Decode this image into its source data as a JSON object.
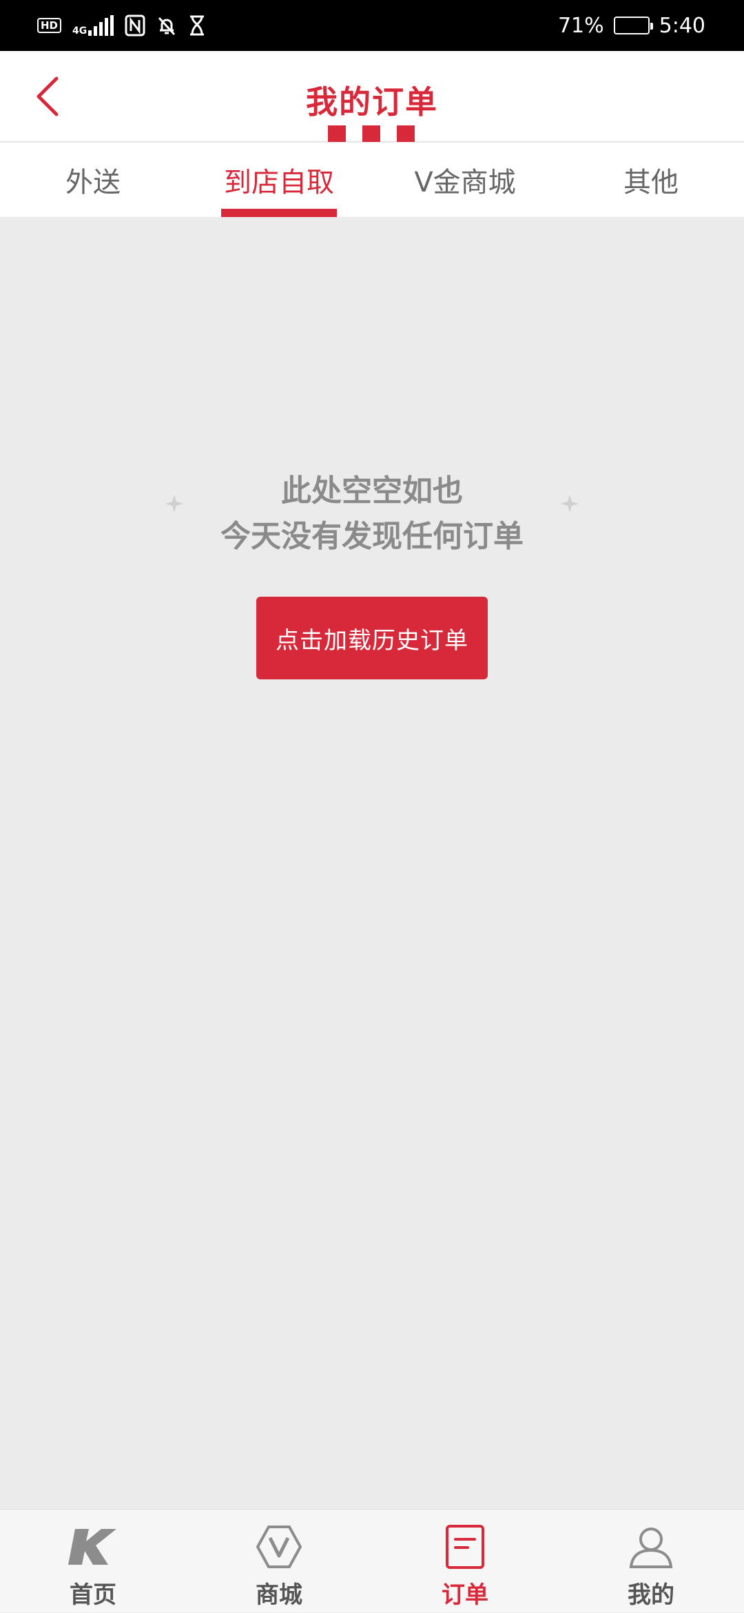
{
  "status_bar": {
    "left_badge": "HD",
    "network": "4G",
    "battery_percent": "71%",
    "battery_level": 0.71,
    "time": "5:40"
  },
  "header": {
    "title": "我的订单"
  },
  "tabs": [
    {
      "label": "外送",
      "active": false
    },
    {
      "label": "到店自取",
      "active": true
    },
    {
      "label": "V金商城",
      "active": false
    },
    {
      "label": "其他",
      "active": false
    }
  ],
  "empty_state": {
    "line1": "此处空空如也",
    "line2": "今天没有发现任何订单",
    "button_label": "点击加载历史订单"
  },
  "bottom_nav": [
    {
      "label": "首页",
      "icon": "kfc-k-logo-icon",
      "active": false
    },
    {
      "label": "商城",
      "icon": "v-hexagon-icon",
      "active": false
    },
    {
      "label": "订单",
      "icon": "order-document-icon",
      "active": true
    },
    {
      "label": "我的",
      "icon": "profile-person-icon",
      "active": false
    }
  ],
  "colors": {
    "brand_red": "#d8293a",
    "background": "#ebebeb",
    "text_gray": "#8a8a8a"
  }
}
